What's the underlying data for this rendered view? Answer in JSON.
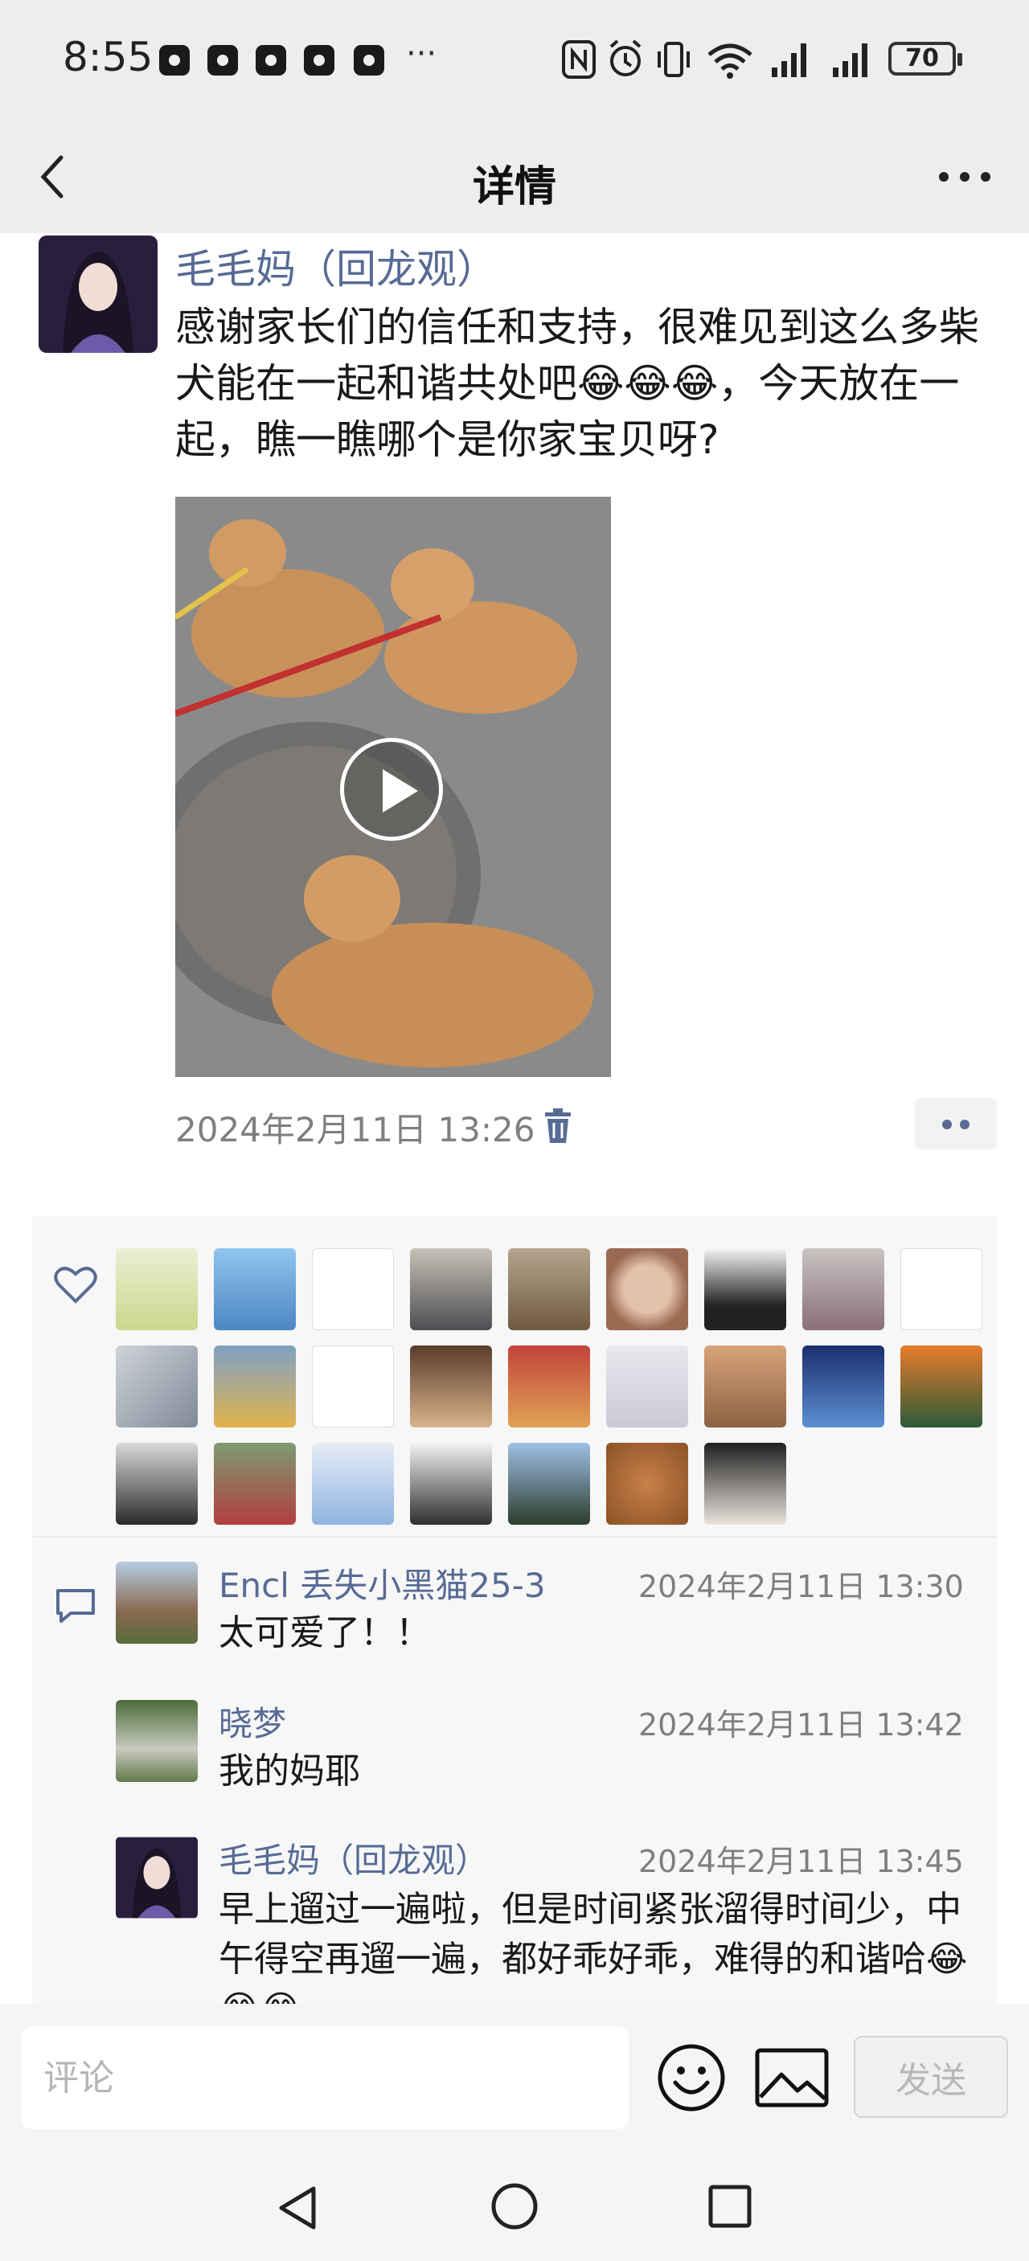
{
  "status_bar": {
    "time": "8:55",
    "overflow": "···",
    "battery": "70",
    "icons": [
      "nfc-icon",
      "alarm-icon",
      "vibrate-icon",
      "wifi-icon",
      "signal-icon",
      "signal-icon"
    ]
  },
  "nav": {
    "title": "详情",
    "back_icon": "chevron-left-icon",
    "more_icon": "more-icon"
  },
  "post": {
    "author": "毛毛妈（回龙观）",
    "text": "感谢家长们的信任和支持，很难见到这么多柴犬能在一起和谐共处吧😂😂😂，今天放在一起，瞧一瞧哪个是你家宝贝呀?",
    "media_type": "video",
    "time": "2024年2月11日 13:26"
  },
  "likes": {
    "icon": "heart-icon",
    "avatar_count": 25
  },
  "comments": [
    {
      "author": "Encl 丢失小黑猫25-3",
      "time": "2024年2月11日 13:30",
      "text": "太可爱了！！"
    },
    {
      "author": "晓梦",
      "time": "2024年2月11日 13:42",
      "text": "我的妈耶"
    },
    {
      "author": "毛毛妈（回龙观）",
      "time": "2024年2月11日 13:45",
      "text": "早上遛过一遍啦，但是时间紧张溜得时间少，中午得空再遛一遍，都好乖好乖，难得的和谐哈😂😂😂"
    }
  ],
  "input": {
    "placeholder": "评论",
    "send_label": "发送"
  },
  "colors": {
    "link": "#576b95",
    "background": "#ededed",
    "panel": "#f7f7f7"
  }
}
